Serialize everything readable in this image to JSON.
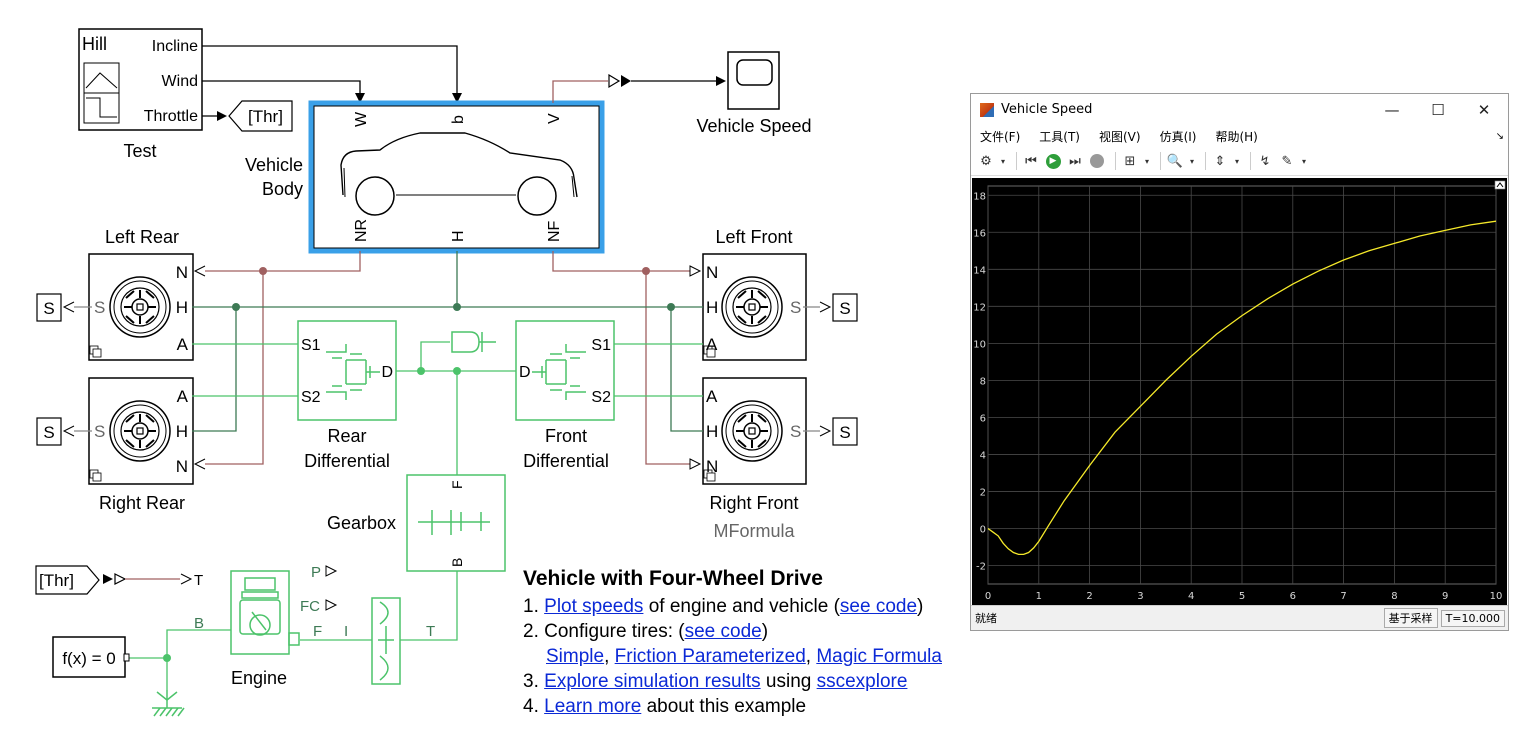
{
  "diagram": {
    "hill_block": {
      "title": "Hill",
      "ports": [
        "Incline",
        "Wind",
        "Throttle"
      ],
      "caption": "Test"
    },
    "goto_thr": "[Thr]",
    "from_thr": "[Thr]",
    "vehicle_body": {
      "caption": "Vehicle Body",
      "ports_top": [
        "W",
        "b",
        "V"
      ],
      "ports_bottom": [
        "NR",
        "H",
        "NF"
      ]
    },
    "scope_caption": "Vehicle Speed",
    "left_rear": {
      "caption": "Left Rear",
      "ports": [
        "N",
        "H",
        "A",
        "S"
      ]
    },
    "right_rear": {
      "caption": "Right Rear",
      "ports": [
        "A",
        "H",
        "N",
        "S"
      ]
    },
    "left_front": {
      "caption": "Left Front",
      "ports": [
        "N",
        "H",
        "A",
        "S"
      ]
    },
    "right_front": {
      "caption": "Right Front",
      "sub": "MFormula",
      "ports": [
        "A",
        "H",
        "N",
        "S"
      ]
    },
    "sensor_label": "S",
    "rear_diff": {
      "caption": "Rear Differential",
      "ports": [
        "S1",
        "S2",
        "D"
      ]
    },
    "front_diff": {
      "caption": "Front Differential",
      "ports": [
        "S1",
        "S2",
        "D"
      ]
    },
    "gearbox": {
      "caption": "Gearbox",
      "ports": [
        "F",
        "B"
      ]
    },
    "engine": {
      "caption": "Engine",
      "ports": [
        "B",
        "F",
        "I",
        "T",
        "P",
        "FC"
      ]
    },
    "solver": "f(x) = 0"
  },
  "info": {
    "title": "Vehicle with Four-Wheel Drive",
    "l1_num": "1.",
    "l1_link": "Plot speeds",
    "l1_mid": " of engine and vehicle (",
    "l1_link2": "see code",
    "l1_end": ")",
    "l2_num": "2.",
    "l2_text": "Configure tires: (",
    "l2_link": "see code",
    "l2_end": ")",
    "l2b_link1": "Simple",
    "l2b_sep1": ", ",
    "l2b_link2": "Friction Parameterized",
    "l2b_sep2": ", ",
    "l2b_link3": "Magic Formula",
    "l3_num": "3.",
    "l3_link": "Explore simulation results",
    "l3_mid": " using ",
    "l3_link2": "sscexplore",
    "l4_num": "4.",
    "l4_link": "Learn more",
    "l4_end": " about this example"
  },
  "scope": {
    "title": "Vehicle Speed",
    "menus": [
      "文件(F)",
      "工具(T)",
      "视图(V)",
      "仿真(I)",
      "帮助(H)"
    ],
    "status_left": "就绪",
    "status_mode": "基于采样",
    "status_time": "T=10.000"
  },
  "chart_data": {
    "type": "line",
    "title": "",
    "xlabel": "",
    "ylabel": "",
    "xlim": [
      0,
      10
    ],
    "ylim": [
      -3,
      18.5
    ],
    "xticks": [
      0,
      1,
      2,
      3,
      4,
      5,
      6,
      7,
      8,
      9,
      10
    ],
    "yticks": [
      -2,
      0,
      2,
      4,
      6,
      8,
      10,
      12,
      14,
      16,
      18
    ],
    "grid": true,
    "background": "#000000",
    "series": [
      {
        "color": "#f5e92a",
        "x": [
          0,
          0.1,
          0.2,
          0.3,
          0.4,
          0.5,
          0.6,
          0.7,
          0.8,
          0.9,
          1.0,
          1.2,
          1.5,
          2.0,
          2.5,
          3.0,
          3.5,
          4.0,
          4.5,
          5.0,
          5.5,
          6.0,
          6.5,
          7.0,
          7.5,
          8.0,
          8.5,
          9.0,
          9.5,
          10.0
        ],
        "y": [
          0,
          -0.2,
          -0.4,
          -0.8,
          -1.1,
          -1.3,
          -1.4,
          -1.4,
          -1.3,
          -1.05,
          -0.7,
          0.2,
          1.5,
          3.4,
          5.2,
          6.6,
          8.0,
          9.3,
          10.5,
          11.5,
          12.4,
          13.2,
          13.9,
          14.5,
          15.0,
          15.4,
          15.8,
          16.1,
          16.4,
          16.6
        ]
      }
    ]
  },
  "colors": {
    "link": "#0b29d6",
    "green": "#4cc36a",
    "dark_green": "#3d7a55",
    "brown": "#a06060",
    "scope_border": "#3aa0e8"
  }
}
